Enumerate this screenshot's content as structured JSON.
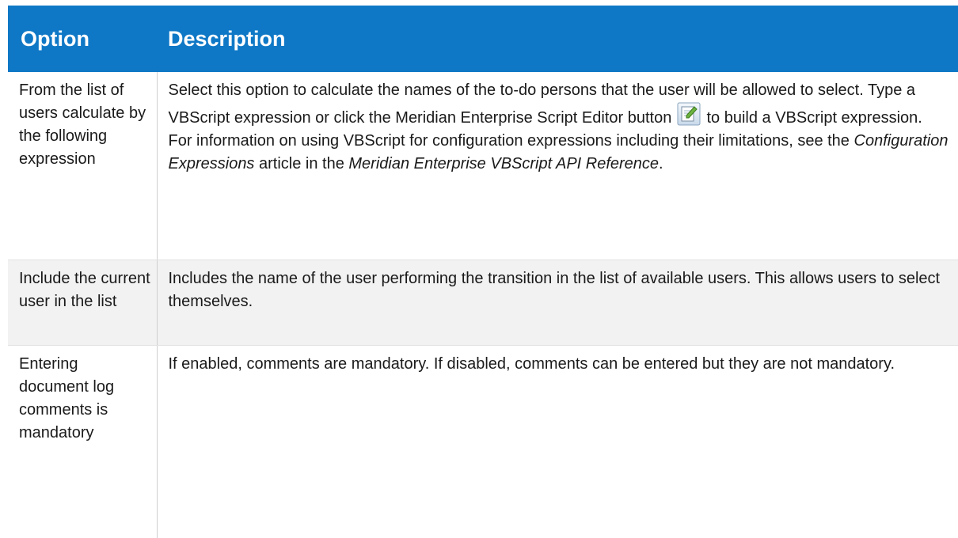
{
  "table": {
    "headers": {
      "option": "Option",
      "description": "Description"
    },
    "rows": [
      {
        "option": "From the list of users calculate by the following expression",
        "desc": {
          "part1": "Select this option to calculate the names of the to-do persons that the user will be allowed to select. Type a VBScript expression or click the Meridian Enterprise Script Editor button",
          "part2": " to build a VBScript expression.  For information on using VBScript for configuration expressions including their limitations, see the ",
          "link1": "Configuration Expressions",
          "part3": " article in the ",
          "link2": "Meridian Enterprise VBScript API Reference",
          "part4": "."
        },
        "icon": "script-editor-icon"
      },
      {
        "option": "Include the current user in the list",
        "desc": "Includes the name of the user performing the transition in the list of available users. This allows users to select themselves."
      },
      {
        "option": "Entering document log comments is mandatory",
        "desc": "If enabled, comments are mandatory. If disabled, comments can be entered but they are not mandatory."
      }
    ]
  },
  "colors": {
    "header_bg": "#0f78c6",
    "header_text": "#ffffff",
    "shaded_row": "#f2f2f2"
  }
}
